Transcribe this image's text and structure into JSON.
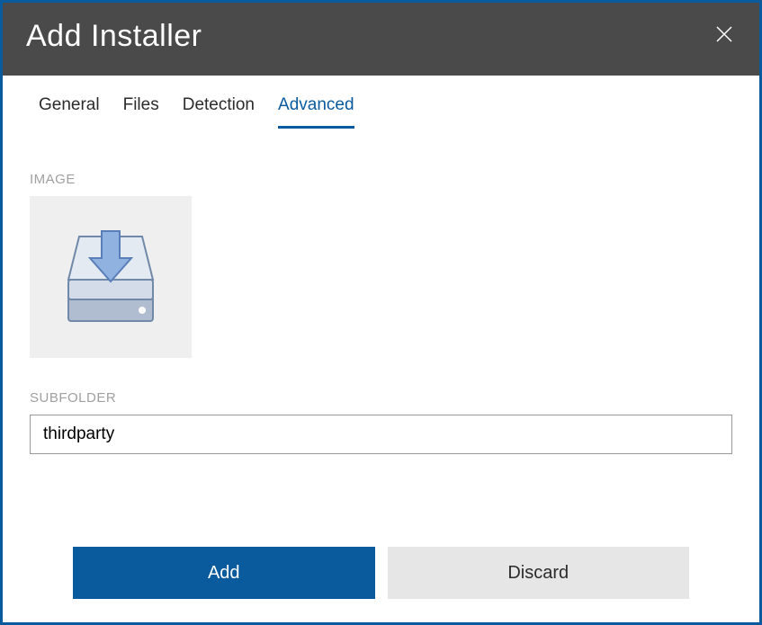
{
  "header": {
    "title": "Add Installer"
  },
  "tabs": [
    {
      "label": "General",
      "active": false
    },
    {
      "label": "Files",
      "active": false
    },
    {
      "label": "Detection",
      "active": false
    },
    {
      "label": "Advanced",
      "active": true
    }
  ],
  "fields": {
    "image": {
      "label": "IMAGE"
    },
    "subfolder": {
      "label": "SUBFOLDER",
      "value": "thirdparty"
    }
  },
  "buttons": {
    "add": "Add",
    "discard": "Discard"
  }
}
